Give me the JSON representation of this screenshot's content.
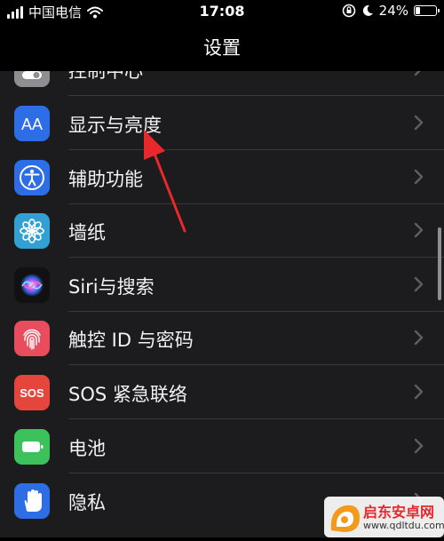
{
  "status_bar": {
    "carrier": "中国电信",
    "time": "17:08",
    "battery_text": "24%",
    "battery_level": 0.24
  },
  "nav": {
    "title": "设置"
  },
  "rows": [
    {
      "label": "控制中心",
      "icon": "control-center-icon",
      "icon_color": "#8e8e93"
    },
    {
      "label": "显示与亮度",
      "icon": "display-brightness-icon",
      "icon_color": "#2d6ee7"
    },
    {
      "label": "辅助功能",
      "icon": "accessibility-icon",
      "icon_color": "#2d6ee7"
    },
    {
      "label": "墙纸",
      "icon": "wallpaper-icon",
      "icon_color": "#32a0d2"
    },
    {
      "label": "Siri与搜索",
      "icon": "siri-icon",
      "icon_color": "#1a1a1a"
    },
    {
      "label": "触控 ID 与密码",
      "icon": "fingerprint-icon",
      "icon_color": "#e94c5c"
    },
    {
      "label": "SOS 紧急联络",
      "icon": "sos-icon",
      "icon_color": "#e5463b"
    },
    {
      "label": "电池",
      "icon": "battery-icon",
      "icon_color": "#3cc25a"
    },
    {
      "label": "隐私",
      "icon": "privacy-hand-icon",
      "icon_color": "#2d6ee7"
    }
  ],
  "annotation": {
    "arrow_color": "#e8282b"
  },
  "watermark": {
    "brand": "启东安卓网",
    "url": "www.qdltdu.com"
  }
}
